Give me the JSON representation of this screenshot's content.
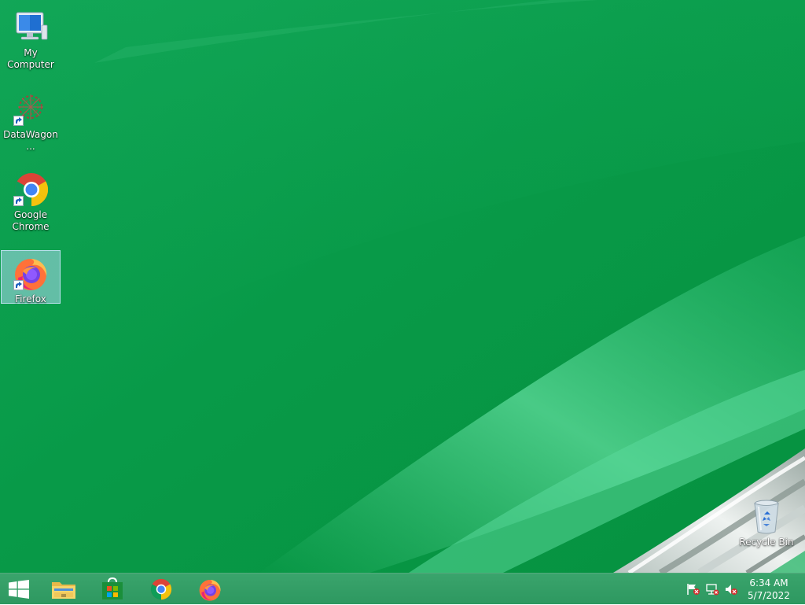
{
  "desktop": {
    "background_color": "#0a9c4a",
    "icons": [
      {
        "label": "My Computer",
        "icon": "computer-icon"
      },
      {
        "label": "DataWagon...",
        "icon": "datawagon-icon"
      },
      {
        "label": "Google Chrome",
        "icon": "chrome-icon"
      },
      {
        "label": "Firefox",
        "icon": "firefox-icon",
        "selected": true
      },
      {
        "label": "Recycle Bin",
        "icon": "recycle-bin-icon"
      }
    ]
  },
  "taskbar": {
    "color": "#2f9a63",
    "pinned": [
      {
        "name": "start-button",
        "icon": "windows-logo-icon"
      },
      {
        "name": "file-explorer-button",
        "icon": "folder-icon"
      },
      {
        "name": "store-button",
        "icon": "store-icon"
      },
      {
        "name": "chrome-taskbar-button",
        "icon": "chrome-icon"
      },
      {
        "name": "firefox-taskbar-button",
        "icon": "firefox-icon"
      }
    ],
    "tray": {
      "icons": [
        "action-center-flag-icon",
        "network-icon",
        "volume-muted-icon"
      ],
      "time": "6:34 AM",
      "date": "5/7/2022"
    }
  }
}
